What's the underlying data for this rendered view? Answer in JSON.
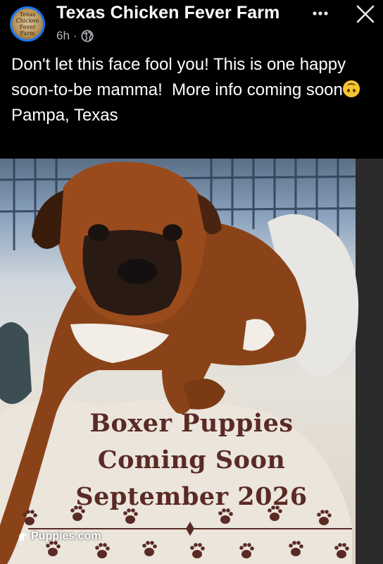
{
  "header": {
    "page_name": "Texas Chicken Fever Farm",
    "avatar_text": "Texas Chicken Fever Farm",
    "timestamp": "6h",
    "separator": "·",
    "audience_icon": "globe-icon",
    "more_icon": "more-horizontal-icon",
    "close_icon": "close-icon"
  },
  "post": {
    "line1": "Don't let this face fool you! This is one happy soon-to-be mamma!  More info coming soon",
    "emoji": "upside-down-face-emoji",
    "line2": "Pampa, Texas"
  },
  "image": {
    "overlay_line1": "Boxer Puppies",
    "overlay_line2": "Coming Soon",
    "overlay_line3": "September 2026",
    "watermark": "Puppies.com",
    "watermark_icon": "dog-icon"
  },
  "colors": {
    "background": "#000000",
    "text": "#ffffff",
    "meta_text": "#b0b3b8",
    "avatar_ring": "#1877f2",
    "overlay_text": "#5a2a24",
    "paw": "#5a2a24"
  }
}
